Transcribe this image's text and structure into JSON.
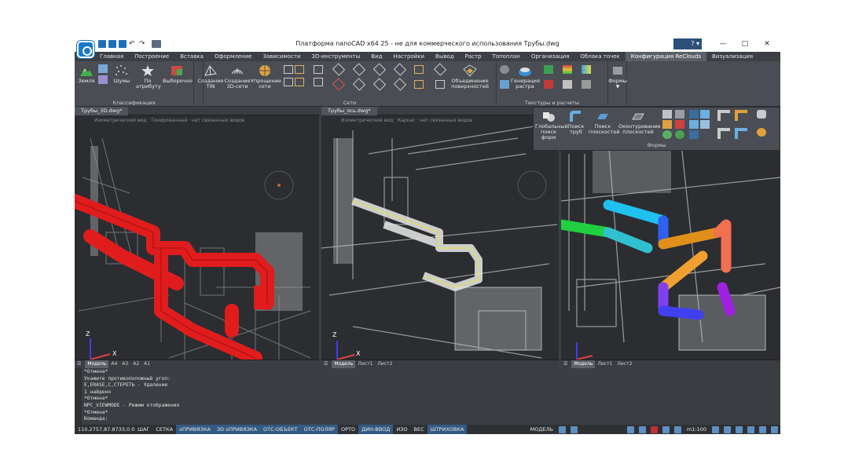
{
  "window": {
    "title": "Платформа nanoCAD x64 25 - не для коммерческого использования Трубы.dwg",
    "help": "? ▾",
    "min": "—",
    "max": "□",
    "close": "✕"
  },
  "menu_tabs": [
    "Главная",
    "Построение",
    "Вставка",
    "Оформление",
    "Зависимости",
    "3D-инструменты",
    "Вид",
    "Настройки",
    "Вывод",
    "Растр",
    "Топоплан",
    "Организация",
    "Облака точек",
    "Конфигурация ReClouds",
    "Визуализация"
  ],
  "ribbon": {
    "classification": {
      "label": "Классификация",
      "earth": "Земля",
      "noise": "Шумы",
      "by_attr": "По атрибуту",
      "selective": "Выборочно"
    },
    "nets": {
      "label": "Сети",
      "create_tin": "Создание TIN",
      "create_3d": "Создание 3D-сети",
      "simplify": "Упрощение сети",
      "merge": "Объединение поверхностей"
    },
    "textures": {
      "label": "Текстуры и расчеты",
      "gen_raster": "Генерация растра"
    },
    "forms_btn": "Формы"
  },
  "forms_panel": {
    "label": "Формы",
    "global_search": "Глобальный поиск форм",
    "pipe_search": "Поиск труб",
    "plane_search": "Поиск плоскостей",
    "contour": "Оконтуривание плоскостей"
  },
  "viewports": [
    {
      "tab": "Трубы_3D.dwg*",
      "view": "Изометрический вид",
      "style": "Тонированный",
      "sets": "нет связанных видов",
      "layouts": [
        "Модель",
        "A4",
        "A3",
        "A2",
        "A1"
      ]
    },
    {
      "tab": "Трубы_ось.dwg*",
      "view": "Изометрический вид",
      "style": "Каркас",
      "sets": "нет связанных видов",
      "layouts": [
        "Модель",
        "Лист1",
        "Лист2"
      ]
    },
    {
      "tab": "",
      "view": "",
      "style": "",
      "sets": "",
      "layouts": [
        "Модель",
        "Лист1",
        "Лист2"
      ]
    }
  ],
  "axis": {
    "z": "Z",
    "x": "X"
  },
  "command_lines": [
    "*Отмена*",
    "Укажите противоположный угол:",
    "E,ERASE,С,СТЕРЕТЬ - Удаление",
    "1 найдено",
    "*Отмена*",
    "NPC_VIEWMODE - Режим отображения",
    "*Отмена*",
    "Команда:"
  ],
  "status": {
    "coords": "110.2757,87.8733,0.0000",
    "items": [
      {
        "t": "ШАГ",
        "on": false
      },
      {
        "t": "СЕТКА",
        "on": false
      },
      {
        "t": "оПРИВЯЗКА",
        "on": true
      },
      {
        "t": "3D оПРИВЯЗКА",
        "on": true
      },
      {
        "t": "ОТС-ОБЪЕКТ",
        "on": true
      },
      {
        "t": "ОТС-ПОЛЯР",
        "on": true
      },
      {
        "t": "ОРТО",
        "on": false
      },
      {
        "t": "ДИН-ВВОД",
        "on": true
      },
      {
        "t": "ИЗО",
        "on": false
      },
      {
        "t": "ВЕС",
        "on": false
      },
      {
        "t": "ШТРИХОВКА",
        "on": true
      }
    ],
    "model": "МОДЕЛЬ",
    "scale": "m1:100"
  },
  "colors": {
    "accent": "#1b79c9",
    "pipe_red": "#e01c1c",
    "pipe_yellow": "#e8e24a"
  }
}
